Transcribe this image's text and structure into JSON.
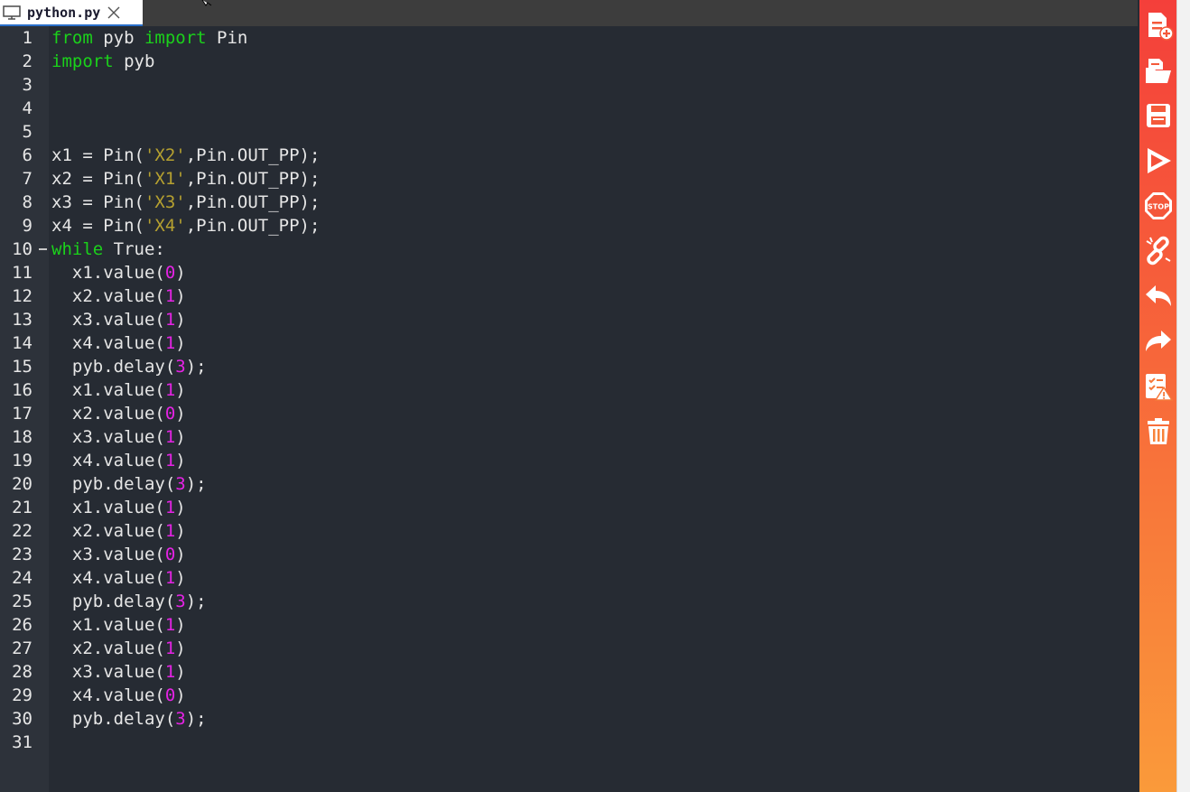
{
  "tab": {
    "label": "python.py",
    "icon": "monitor-icon",
    "close_icon": "close-icon"
  },
  "editor": {
    "colors": {
      "background": "#262b33",
      "keyword": "#1bd11b",
      "string": "#b5a030",
      "number": "#e523e5",
      "text": "#e6e6e6"
    },
    "lines": [
      {
        "n": "1",
        "tokens": [
          [
            "kw",
            "from"
          ],
          [
            "t",
            " pyb "
          ],
          [
            "kw",
            "import"
          ],
          [
            "t",
            " Pin"
          ]
        ]
      },
      {
        "n": "2",
        "tokens": [
          [
            "kw",
            "import"
          ],
          [
            "t",
            " pyb"
          ]
        ]
      },
      {
        "n": "3",
        "tokens": []
      },
      {
        "n": "4",
        "tokens": []
      },
      {
        "n": "5",
        "tokens": []
      },
      {
        "n": "6",
        "tokens": [
          [
            "t",
            "x1 = Pin("
          ],
          [
            "str",
            "'X2'"
          ],
          [
            "t",
            ",Pin.OUT_PP);"
          ]
        ]
      },
      {
        "n": "7",
        "tokens": [
          [
            "t",
            "x2 = Pin("
          ],
          [
            "str",
            "'X1'"
          ],
          [
            "t",
            ",Pin.OUT_PP);"
          ]
        ]
      },
      {
        "n": "8",
        "tokens": [
          [
            "t",
            "x3 = Pin("
          ],
          [
            "str",
            "'X3'"
          ],
          [
            "t",
            ",Pin.OUT_PP);"
          ]
        ]
      },
      {
        "n": "9",
        "tokens": [
          [
            "t",
            "x4 = Pin("
          ],
          [
            "str",
            "'X4'"
          ],
          [
            "t",
            ",Pin.OUT_PP);"
          ]
        ]
      },
      {
        "n": "10",
        "fold": true,
        "tokens": [
          [
            "kw",
            "while"
          ],
          [
            "t",
            " True:"
          ]
        ]
      },
      {
        "n": "11",
        "tokens": [
          [
            "t",
            "  x1.value("
          ],
          [
            "num",
            "0"
          ],
          [
            "t",
            ")"
          ]
        ]
      },
      {
        "n": "12",
        "tokens": [
          [
            "t",
            "  x2.value("
          ],
          [
            "num",
            "1"
          ],
          [
            "t",
            ")"
          ]
        ]
      },
      {
        "n": "13",
        "tokens": [
          [
            "t",
            "  x3.value("
          ],
          [
            "num",
            "1"
          ],
          [
            "t",
            ")"
          ]
        ]
      },
      {
        "n": "14",
        "tokens": [
          [
            "t",
            "  x4.value("
          ],
          [
            "num",
            "1"
          ],
          [
            "t",
            ")"
          ]
        ]
      },
      {
        "n": "15",
        "tokens": [
          [
            "t",
            "  pyb.delay("
          ],
          [
            "num",
            "3"
          ],
          [
            "t",
            ");"
          ]
        ]
      },
      {
        "n": "16",
        "tokens": [
          [
            "t",
            "  x1.value("
          ],
          [
            "num",
            "1"
          ],
          [
            "t",
            ")"
          ]
        ]
      },
      {
        "n": "17",
        "tokens": [
          [
            "t",
            "  x2.value("
          ],
          [
            "num",
            "0"
          ],
          [
            "t",
            ")"
          ]
        ]
      },
      {
        "n": "18",
        "tokens": [
          [
            "t",
            "  x3.value("
          ],
          [
            "num",
            "1"
          ],
          [
            "t",
            ")"
          ]
        ]
      },
      {
        "n": "19",
        "tokens": [
          [
            "t",
            "  x4.value("
          ],
          [
            "num",
            "1"
          ],
          [
            "t",
            ")"
          ]
        ]
      },
      {
        "n": "20",
        "tokens": [
          [
            "t",
            "  pyb.delay("
          ],
          [
            "num",
            "3"
          ],
          [
            "t",
            ");"
          ]
        ]
      },
      {
        "n": "21",
        "tokens": [
          [
            "t",
            "  x1.value("
          ],
          [
            "num",
            "1"
          ],
          [
            "t",
            ")"
          ]
        ]
      },
      {
        "n": "22",
        "tokens": [
          [
            "t",
            "  x2.value("
          ],
          [
            "num",
            "1"
          ],
          [
            "t",
            ")"
          ]
        ]
      },
      {
        "n": "23",
        "tokens": [
          [
            "t",
            "  x3.value("
          ],
          [
            "num",
            "0"
          ],
          [
            "t",
            ")"
          ]
        ]
      },
      {
        "n": "24",
        "tokens": [
          [
            "t",
            "  x4.value("
          ],
          [
            "num",
            "1"
          ],
          [
            "t",
            ")"
          ]
        ]
      },
      {
        "n": "25",
        "tokens": [
          [
            "t",
            "  pyb.delay("
          ],
          [
            "num",
            "3"
          ],
          [
            "t",
            ");"
          ]
        ]
      },
      {
        "n": "26",
        "tokens": [
          [
            "t",
            "  x1.value("
          ],
          [
            "num",
            "1"
          ],
          [
            "t",
            ")"
          ]
        ]
      },
      {
        "n": "27",
        "tokens": [
          [
            "t",
            "  x2.value("
          ],
          [
            "num",
            "1"
          ],
          [
            "t",
            ")"
          ]
        ]
      },
      {
        "n": "28",
        "tokens": [
          [
            "t",
            "  x3.value("
          ],
          [
            "num",
            "1"
          ],
          [
            "t",
            ")"
          ]
        ]
      },
      {
        "n": "29",
        "tokens": [
          [
            "t",
            "  x4.value("
          ],
          [
            "num",
            "0"
          ],
          [
            "t",
            ")"
          ]
        ]
      },
      {
        "n": "30",
        "tokens": [
          [
            "t",
            "  pyb.delay("
          ],
          [
            "num",
            "3"
          ],
          [
            "t",
            ");"
          ]
        ]
      },
      {
        "n": "31",
        "tokens": []
      }
    ]
  },
  "toolbar": {
    "colors": {
      "top": "#f43f3a",
      "bottom": "#fa9a3a"
    },
    "buttons": [
      "new-file-icon",
      "open-folder-icon",
      "save-icon",
      "run-icon",
      "stop-icon",
      "connect-icon",
      "undo-icon",
      "redo-icon",
      "check-errors-icon",
      "clear-icon"
    ],
    "stop_label": "STOP"
  }
}
